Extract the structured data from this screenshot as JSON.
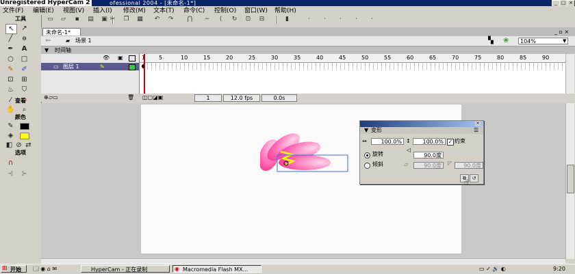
{
  "window": {
    "overlay_title": "Unregistered HyperCam 2",
    "title_rest": "ofessional 2004 - [未命名-1*]",
    "controls": [
      "_",
      "□",
      "×"
    ]
  },
  "menu": [
    "文件(F)",
    "编辑(E)",
    "视图(V)",
    "插入(I)",
    "修改(M)",
    "文本(T)",
    "命令(C)",
    "控制(O)",
    "窗口(W)",
    "帮助(H)"
  ],
  "toolbar_icons": [
    "new-icon",
    "open-icon",
    "save-icon",
    "print-icon",
    "print-preview-icon",
    "cut-icon",
    "copy-icon",
    "paste-icon",
    "undo-icon",
    "redo-icon",
    "snap-icon",
    "smooth-icon",
    "straighten-icon",
    "rotate-icon",
    "scale-icon",
    "align-icon"
  ],
  "tools": {
    "title": "工具",
    "view_title": "查看",
    "colors_title": "颜色",
    "options_title": "选项",
    "colors": {
      "stroke": "#000000",
      "fill": "#ffff00"
    }
  },
  "document": {
    "tab": "未命名-1*",
    "scene": "场景 1",
    "zoom": "104%"
  },
  "timeline": {
    "title": "时间轴",
    "layer_name": "图层 1",
    "frame_numbers": [
      "1",
      "5",
      "10",
      "15",
      "20",
      "25",
      "30",
      "35",
      "40",
      "45",
      "50",
      "55",
      "60",
      "65",
      "70",
      "75",
      "80",
      "85",
      "90"
    ],
    "current_frame": "1",
    "fps": "12.0 fps",
    "time": "0.0s"
  },
  "transform_panel": {
    "title": "变形",
    "width": "100.0%",
    "height": "100.0%",
    "constrain": "约束",
    "rotate_label": "旋转",
    "rotate_value": "90.0度",
    "skew_label": "倾斜",
    "skew_h": "90.0度",
    "skew_v": "90.0度"
  },
  "taskbar": {
    "start": "开始",
    "tasks": [
      "HyperCam - 正在录制",
      "Macromedia Flash MX..."
    ],
    "clock": "9:20"
  },
  "colors": {
    "petal": "#ff3f9a",
    "accent": "#ffff00",
    "titlebar": "#0a246a"
  }
}
